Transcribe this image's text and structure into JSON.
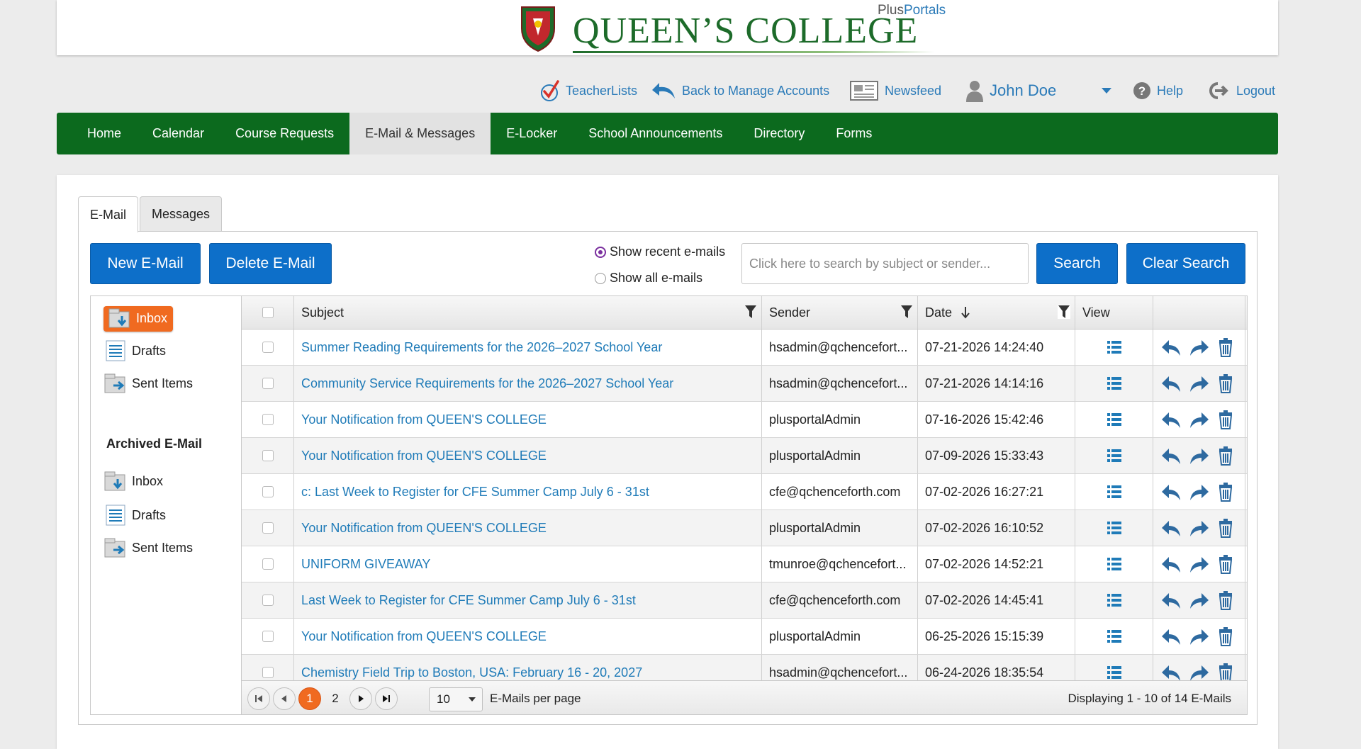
{
  "header": {
    "college_name": "QUEEN’S COLLEGE",
    "brand_plus": "Plus",
    "brand_portals": "Portals"
  },
  "utility": {
    "teacherlists": "TeacherLists",
    "back_to_manage": "Back to Manage Accounts",
    "newsfeed": "Newsfeed",
    "user_name": "John Doe",
    "help": "Help",
    "logout": "Logout"
  },
  "nav": {
    "items": [
      "Home",
      "Calendar",
      "Course Requests",
      "E-Mail & Messages",
      "E-Locker",
      "School Announcements",
      "Directory",
      "Forms"
    ],
    "active": "E-Mail & Messages"
  },
  "tabs": {
    "email": "E-Mail",
    "messages": "Messages"
  },
  "toolbar": {
    "new_email": "New E-Mail",
    "delete_email": "Delete E-Mail",
    "show_recent": "Show recent e-mails",
    "show_all": "Show all e-mails",
    "search_placeholder": "Click here to search by subject or sender...",
    "search": "Search",
    "clear_search": "Clear Search"
  },
  "folders": {
    "inbox": "Inbox",
    "drafts": "Drafts",
    "sent": "Sent Items",
    "archived_heading": "Archived E-Mail",
    "archived_inbox": "Inbox",
    "archived_drafts": "Drafts",
    "archived_sent": "Sent Items"
  },
  "grid": {
    "columns": {
      "subject": "Subject",
      "sender": "Sender",
      "date": "Date",
      "view": "View"
    },
    "rows": [
      {
        "subject": "Summer Reading Requirements for the 2026–2027 School Year",
        "sender": "hsadmin@qchencefort...",
        "date": "07-21-2026 14:24:40"
      },
      {
        "subject": "Community Service Requirements for the 2026–2027 School Year",
        "sender": "hsadmin@qchencefort...",
        "date": "07-21-2026 14:14:16"
      },
      {
        "subject": "Your Notification from QUEEN'S COLLEGE",
        "sender": "plusportalAdmin",
        "date": "07-16-2026 15:42:46"
      },
      {
        "subject": "Your Notification from QUEEN'S COLLEGE",
        "sender": "plusportalAdmin",
        "date": "07-09-2026 15:33:43"
      },
      {
        "subject": "c: Last Week to Register for CFE Summer Camp July 6 - 31st",
        "sender": "cfe@qchenceforth.com",
        "date": "07-02-2026 16:27:21"
      },
      {
        "subject": "Your Notification from QUEEN'S COLLEGE",
        "sender": "plusportalAdmin",
        "date": "07-02-2026 16:10:52"
      },
      {
        "subject": "UNIFORM GIVEAWAY",
        "sender": "tmunroe@qchencefort...",
        "date": "07-02-2026 14:52:21"
      },
      {
        "subject": "Last Week to Register for CFE Summer Camp July 6 - 31st",
        "sender": "cfe@qchenceforth.com",
        "date": "07-02-2026 14:45:41"
      },
      {
        "subject": "Your Notification from QUEEN'S COLLEGE",
        "sender": "plusportalAdmin",
        "date": "06-25-2026 15:15:39"
      },
      {
        "subject": "Chemistry Field Trip to Boston, USA: February 16 - 20, 2027",
        "sender": "hsadmin@qchencefort...",
        "date": "06-24-2026 18:35:54"
      }
    ]
  },
  "pager": {
    "pages": [
      "1",
      "2"
    ],
    "current": "1",
    "page_size": "10",
    "per_page_label": "E-Mails per page",
    "info": "Displaying 1 - 10 of 14 E-Mails"
  },
  "colors": {
    "nav_green": "#0c6a1e",
    "accent_orange": "#f06a20",
    "button_blue": "#0d6fc9",
    "link_blue": "#1f7bb8"
  }
}
